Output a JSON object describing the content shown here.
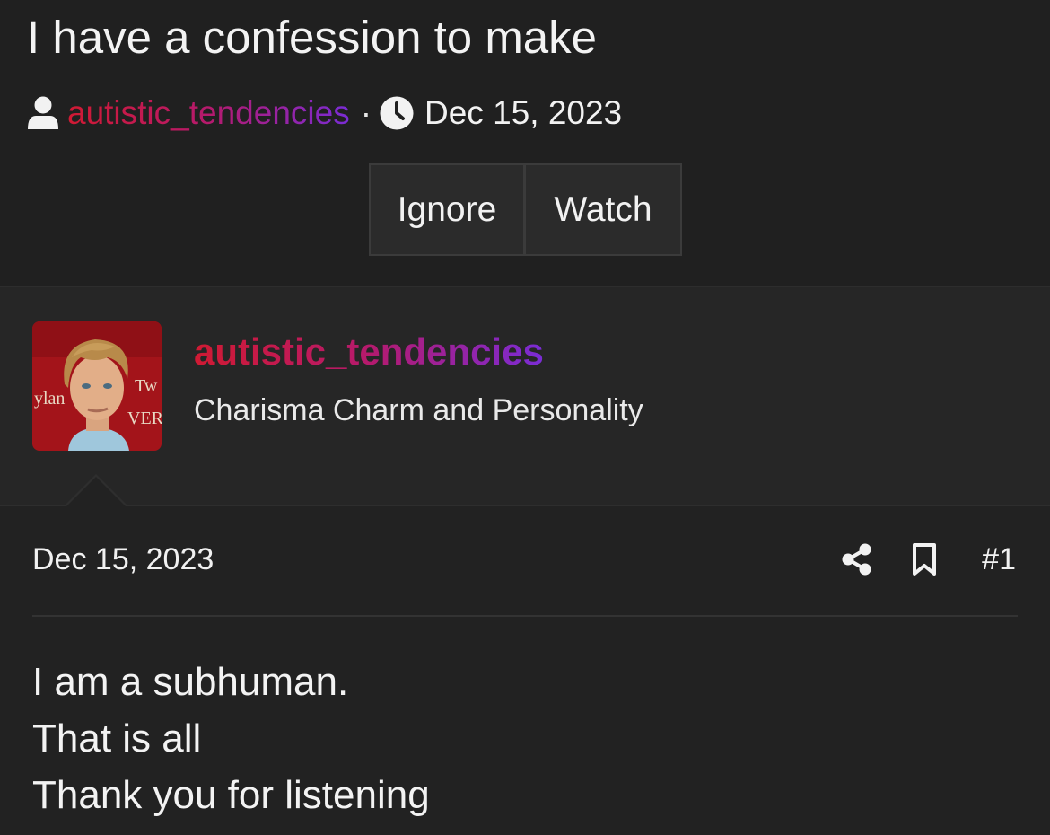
{
  "thread": {
    "title": "I have a confession to make",
    "author": "autistic_tendencies",
    "separator": "·",
    "date": "Dec 15, 2023",
    "buttons": {
      "ignore": "Ignore",
      "watch": "Watch"
    }
  },
  "post": {
    "username": "autistic_tendencies",
    "user_title": "Charisma Charm and Personality",
    "date": "Dec 15, 2023",
    "post_number": "#1",
    "body": [
      "I am a subhuman.",
      "That is all",
      "Thank you for listening"
    ]
  },
  "colors": {
    "background": "#202020",
    "post_background": "#222222",
    "user_block_background": "#262626",
    "username_gradient_start": "#d01a33",
    "username_gradient_end": "#7a2cd6",
    "text": "#f2f2f2"
  },
  "icons": {
    "author": "user-icon",
    "date": "clock-icon",
    "share": "share-icon",
    "bookmark": "bookmark-icon"
  }
}
